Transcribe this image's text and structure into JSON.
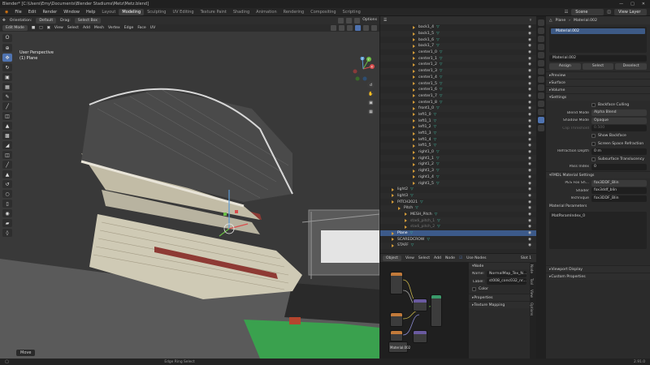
{
  "window": {
    "title": "Blender* [C:\\Users\\Emy\\Documents\\Blender Stadiums\\Metz\\Metz.blend]"
  },
  "menu": [
    "File",
    "Edit",
    "Render",
    "Window",
    "Help"
  ],
  "workspace_tabs": [
    {
      "label": "Layout",
      "active": false
    },
    {
      "label": "Modeling",
      "active": true
    },
    {
      "label": "Sculpting",
      "active": false
    },
    {
      "label": "UV Editing",
      "active": false
    },
    {
      "label": "Texture Paint",
      "active": false
    },
    {
      "label": "Shading",
      "active": false
    },
    {
      "label": "Animation",
      "active": false
    },
    {
      "label": "Rendering",
      "active": false
    },
    {
      "label": "Compositing",
      "active": false
    },
    {
      "label": "Scripting",
      "active": false
    }
  ],
  "top_right": {
    "scene": "Scene",
    "view_layer": "View Layer"
  },
  "viewport": {
    "orientation_label": "Orientation:",
    "orientation_value": "Default",
    "drag_label": "Drag:",
    "drag_value": "Select Box",
    "mode": "Edit Mode",
    "header_menus": [
      "View",
      "Select",
      "Add",
      "Mesh",
      "Vertex",
      "Edge",
      "Face",
      "UV"
    ],
    "options": "Options",
    "info_line1": "User Perspective",
    "info_line2": "(1) Plane",
    "footer_hint": "Move",
    "gizmo": {
      "x": "X",
      "y": "Y",
      "z": "Z"
    }
  },
  "outliner": {
    "items": [
      {
        "label": "back1_4",
        "grey": false
      },
      {
        "label": "back1_5",
        "grey": false
      },
      {
        "label": "back1_6",
        "grey": false
      },
      {
        "label": "back1_7",
        "grey": false
      },
      {
        "label": "center1_0",
        "grey": false
      },
      {
        "label": "center1_1",
        "grey": false
      },
      {
        "label": "center1_2",
        "grey": false
      },
      {
        "label": "center1_3",
        "grey": false
      },
      {
        "label": "center1_4",
        "grey": false
      },
      {
        "label": "center1_5",
        "grey": false
      },
      {
        "label": "center1_6",
        "grey": false
      },
      {
        "label": "center1_7",
        "grey": false
      },
      {
        "label": "center1_8",
        "grey": false
      },
      {
        "label": "front1_0",
        "grey": false
      },
      {
        "label": "left1_0",
        "grey": false
      },
      {
        "label": "left1_1",
        "grey": false
      },
      {
        "label": "left1_2",
        "grey": false
      },
      {
        "label": "left1_3",
        "grey": false
      },
      {
        "label": "left1_4",
        "grey": false
      },
      {
        "label": "left1_5",
        "grey": false
      },
      {
        "label": "right1_0",
        "grey": false
      },
      {
        "label": "right1_1",
        "grey": false
      },
      {
        "label": "right1_2",
        "grey": false
      },
      {
        "label": "right1_3",
        "grey": false
      },
      {
        "label": "right1_4",
        "grey": false
      },
      {
        "label": "right1_5",
        "grey": false
      },
      {
        "label": "light2",
        "grey": false
      },
      {
        "label": "light3",
        "grey": false
      },
      {
        "label": "PITCH2021",
        "grey": false
      },
      {
        "label": "Pitch",
        "grey": false
      },
      {
        "label": "MESH_Pitch",
        "grey": false
      },
      {
        "label": "stadi_pitch_1",
        "grey": true
      },
      {
        "label": "stadi_pitch_2",
        "grey": true
      },
      {
        "label": "Plane",
        "grey": false
      },
      {
        "label": "SCAREDCROW",
        "grey": false
      },
      {
        "label": "STAFF",
        "grey": false
      }
    ]
  },
  "properties": {
    "object_name": "Plane",
    "material_name": "Material.002",
    "slot_item": "Material.002",
    "assign": "Assign",
    "select": "Select",
    "deselect": "Deselect",
    "sections": [
      "Preview",
      "Surface",
      "Volume"
    ],
    "settings_label": "Settings",
    "backface_culling": "Backface Culling",
    "blend_mode_label": "Blend Mode",
    "blend_mode_value": "Alpha Blend",
    "shadow_mode_label": "Shadow Mode",
    "shadow_mode_value": "Opaque",
    "clip_threshold_label": "Clip Threshold",
    "clip_threshold_value": "0.500",
    "show_backface": "Show Backface",
    "ssr": "Screen Space Refraction",
    "refraction_depth_label": "Refraction Depth",
    "refraction_depth_value": "0 m",
    "subsurface_translucency": "Subsurface Translucency",
    "pass_index_label": "Pass Index",
    "pass_index_value": "0",
    "fmdl_title": "FMDL Material Settings",
    "fox_shader_label": "PES Fox Sh...",
    "fox_shader_value": "fox3DDF_Blin",
    "shader_label": "Shader",
    "shader_value": "fox3ddf_blin",
    "technique_label": "Technique",
    "technique_value": "fox3DDF_Blin",
    "material_params_title": "Material Parameters",
    "material_param_item": "MatParamIndex_0",
    "viewport_display": "Viewport Display",
    "custom_properties": "Custom Properties"
  },
  "node_editor": {
    "mode": "Object",
    "menus": [
      "View",
      "Select",
      "Add",
      "Node"
    ],
    "use_nodes": "Use Nodes",
    "slot": "Slot 1",
    "node_panel_title": "Node",
    "name_label": "Name:",
    "name_value": "NormalMap_Tex_N...",
    "label_label": "Label:",
    "label_value": "st008_conc032_nr...",
    "color_label": "Color",
    "properties_label": "Properties",
    "texture_mapping": "Texture Mapping",
    "bottom_material": "Material.002",
    "tabs": [
      "Node",
      "Tool",
      "View",
      "Options"
    ]
  },
  "status": {
    "left": "Edge Ring Select",
    "right": "2.91.0"
  },
  "colors": {
    "accent": "#4f73b0",
    "bg": "#393939",
    "outliner_sel": "#3c5a8a",
    "material": "#3fb39b",
    "pitch": "#3aa14e"
  }
}
